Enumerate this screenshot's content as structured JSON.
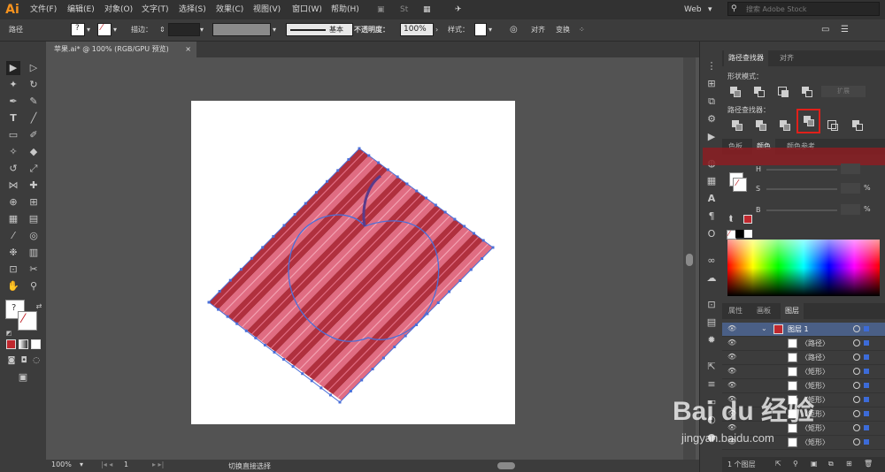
{
  "app": {
    "logo": "Ai",
    "accent": "#f7931e"
  },
  "menu": [
    "文件(F)",
    "编辑(E)",
    "对象(O)",
    "文字(T)",
    "选择(S)",
    "效果(C)",
    "视图(V)",
    "窗口(W)",
    "帮助(H)"
  ],
  "workspace": "Web",
  "search_placeholder": "搜索 Adobe Stock",
  "control": {
    "object_type": "路径",
    "stroke_label": "描边：",
    "stroke_style": "基本",
    "opacity_label": "不透明度：",
    "opacity_value": "100%",
    "style_label": "样式：",
    "align_label": "对齐",
    "transform_label": "变换"
  },
  "document_tab": {
    "title": "苹果.ai* @ 100% (RGB/GPU 预览)",
    "close": "×"
  },
  "status": {
    "zoom": "100%",
    "artboard": "1",
    "hint": "切换直接选择"
  },
  "pathfinder": {
    "tabs": [
      "路径查找器",
      "对齐"
    ],
    "shape_modes_label": "形状模式：",
    "expand_label": "扩展",
    "pathfinders_label": "路径查找器：",
    "highlight_color": "#e0201a"
  },
  "color_panel": {
    "tabs": [
      "色板",
      "颜色",
      "颜色参考"
    ],
    "channels": [
      "H",
      "S",
      "B"
    ],
    "percent": "%"
  },
  "layers_panel": {
    "tabs": [
      "属性",
      "画板",
      "图层"
    ],
    "layer_name": "图层 1",
    "rows": [
      "〈路径〉",
      "〈路径〉",
      "〈矩形〉",
      "〈矩形〉",
      "〈矩形〉",
      "〈矩形〉",
      "〈矩形〉",
      "〈矩形〉"
    ],
    "footer": "1 个图层"
  },
  "artwork": {
    "stripe_dark": "#b0303e",
    "stripe_light": "#e06c82",
    "path_color": "#4a6fd8"
  },
  "watermark": {
    "brand": "Bai du 经验",
    "url": "jingyan.baidu.com"
  }
}
